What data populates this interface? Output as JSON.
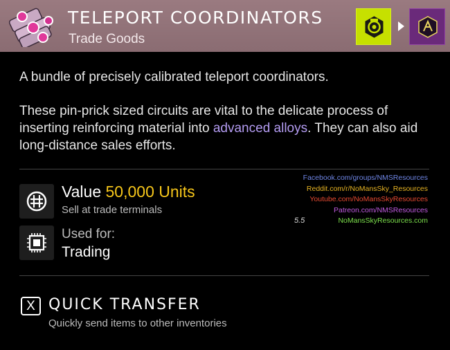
{
  "item": {
    "name": "TELEPORT COORDINATORS",
    "category": "Trade Goods",
    "icon": "teleport-coordinators-icon",
    "header_color": "#9a7a80"
  },
  "refine": {
    "input_icon": "refined-gold-icon",
    "input_color": "#c6e000",
    "output_icon": "trade-crystal-icon",
    "output_color": "#6a2a7a"
  },
  "description": {
    "line1": "A bundle of precisely calibrated teleport coordinators.",
    "para2_before": "These pin-prick sized circuits are vital to the delicate process of inserting reinforcing material into ",
    "para2_link": "advanced alloys",
    "para2_after": ". They can also aid long-distance sales efforts.",
    "link_color": "#b49cf2"
  },
  "value": {
    "label": "Value",
    "amount": "50,000 Units",
    "amount_color": "#f6c61a",
    "subtext": "Sell at trade terminals",
    "icon": "units-icon"
  },
  "usage": {
    "label": "Used for:",
    "value": "Trading",
    "icon": "chip-icon"
  },
  "credits": {
    "facebook": "Facebook.com/groups/NMSResources",
    "reddit": "Reddit.com/r/NoMansSky_Resources",
    "youtube": "Youtube.com/NoMansSkyResources",
    "patreon": "Patreon.com/NMSResources",
    "site": "NoMansSkyResources.com",
    "version": "5.5"
  },
  "quick_transfer": {
    "key": "X",
    "title": "QUICK TRANSFER",
    "subtitle": "Quickly send items to other inventories"
  }
}
